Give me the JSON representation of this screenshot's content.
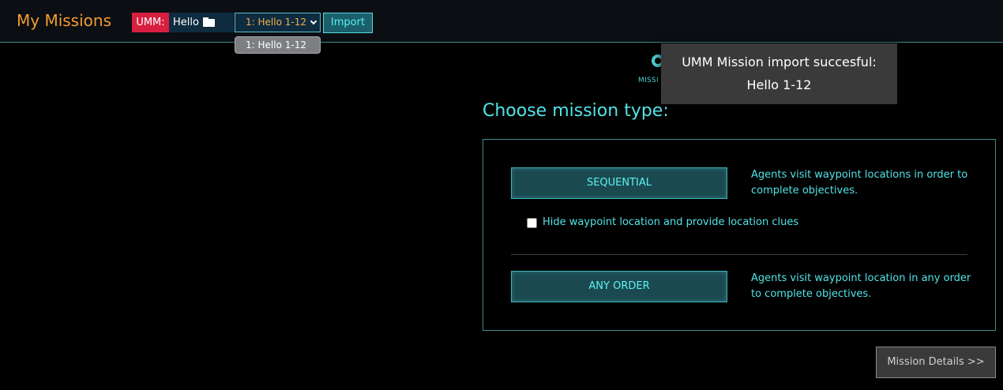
{
  "header": {
    "title": "My Missions",
    "umm_label": "UMM:",
    "file_name": "Hello",
    "selected_mission": "1: Hello 1-12",
    "import_label": "Import",
    "dropdown_option": "1: Hello 1-12"
  },
  "logo": {
    "text": "MISSI"
  },
  "toast": {
    "title": "UMM Mission import succesful:",
    "subtitle": "Hello 1-12"
  },
  "main": {
    "heading": "Choose mission type:",
    "sequential": {
      "label": "SEQUENTIAL",
      "description": "Agents visit waypoint locations in order to complete objectives."
    },
    "hide_waypoint": {
      "label": "Hide waypoint location and provide location clues",
      "checked": false
    },
    "any_order": {
      "label": "ANY ORDER",
      "description": "Agents visit waypoint location in any order to complete objectives."
    },
    "details_label": "Mission Details >>"
  },
  "colors": {
    "accent": "#52e3e6",
    "title": "#f39c32",
    "umm_badge": "#d81f40"
  }
}
